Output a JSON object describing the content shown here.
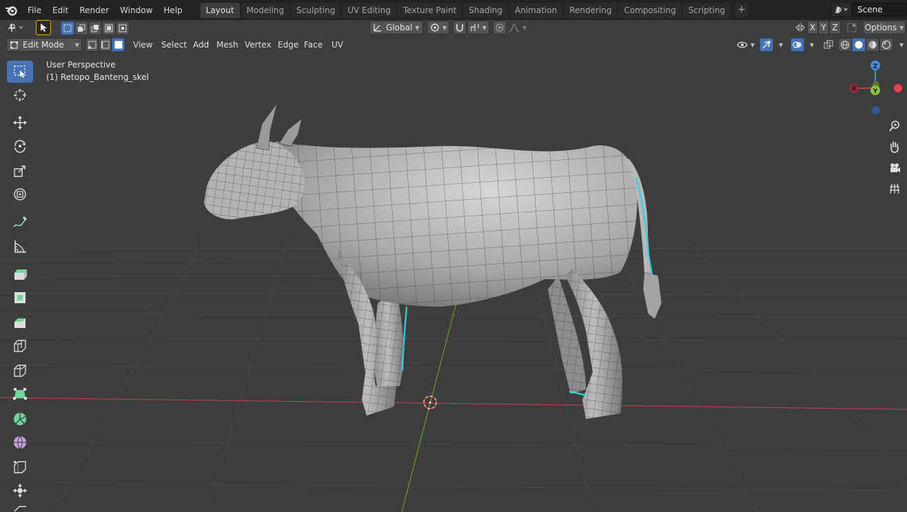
{
  "topbar": {
    "menus": [
      "File",
      "Edit",
      "Render",
      "Window",
      "Help"
    ],
    "workspaces": [
      "Layout",
      "Modeling",
      "Sculpting",
      "UV Editing",
      "Texture Paint",
      "Shading",
      "Animation",
      "Rendering",
      "Compositing",
      "Scripting"
    ],
    "active_workspace": "Layout",
    "add_workspace": "+",
    "scene_name": "Scene"
  },
  "tool_settings": {
    "orientation": "Global",
    "axis_x": "X",
    "axis_y": "Y",
    "axis_z": "Z",
    "options": "Options"
  },
  "header": {
    "mode": "Edit Mode",
    "menus": [
      "View",
      "Select",
      "Add",
      "Mesh",
      "Vertex",
      "Edge",
      "Face",
      "UV"
    ]
  },
  "viewport": {
    "view_name": "User Perspective",
    "object_name": "(1) Retopo_Banteng_skel"
  },
  "gizmo": {
    "x": "X",
    "y": "Y",
    "z": "Z"
  },
  "colors": {
    "accent": "#4772b3",
    "axis_x": "#e8434f",
    "axis_y": "#8bc441",
    "axis_z": "#3d8ee4",
    "seam": "#2ed2e6"
  },
  "icons": {
    "toolbar": [
      "select-box-icon",
      "cursor-icon",
      "move-icon",
      "rotate-icon",
      "scale-icon",
      "transform-icon",
      "annotate-icon",
      "measure-icon",
      "extrude-icon",
      "inset-icon",
      "bevel-icon",
      "loop-cut-icon",
      "knife-icon",
      "poly-build-icon",
      "spin-icon",
      "smooth-icon",
      "edge-slide-icon",
      "shrink-fatten-icon"
    ],
    "nav": [
      "zoom-icon",
      "pan-icon",
      "camera-icon",
      "grid-icon"
    ]
  }
}
